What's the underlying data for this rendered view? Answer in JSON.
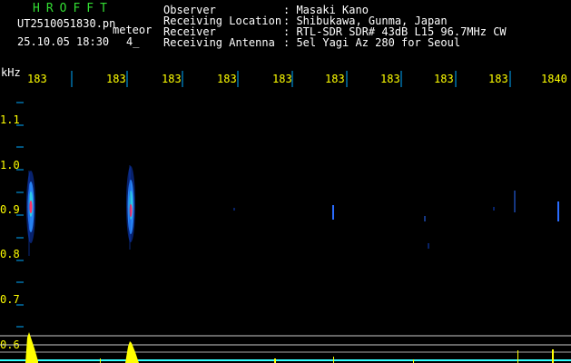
{
  "header": {
    "logo": "HROFFT",
    "filename": "UT2510051830.pn",
    "meteor_label": "meteor",
    "datetime": "25.10.05 18:30",
    "count": "4_",
    "info_labels": [
      "Observer",
      "Receiving Location",
      "Receiver",
      "Receiving Antenna"
    ],
    "info_values": [
      ": Masaki Kano",
      ": Shibukawa, Gunma, Japan",
      ": RTL-SDR SDR# 43dB L15 96.7MHz CW",
      ": 5el Yagi Az 280 for Seoul"
    ]
  },
  "axis": {
    "unit": "kHz",
    "y_ticks": [
      "1.1",
      "1.0",
      "0.9",
      "0.8",
      "0.7",
      "0.6"
    ],
    "x_ticks": [
      "183",
      "183",
      "183",
      "183",
      "183",
      "183",
      "183",
      "183",
      "183",
      "1840"
    ]
  },
  "colors": {
    "background": "#000000",
    "text_white": "#ffffff",
    "text_yellow": "#ffff00",
    "logo_green": "#33dd33",
    "tick_marks": "#00aaff",
    "signal_core": "#ff3366",
    "signal_mid": "#33aaff",
    "signal_outer": "#1144cc",
    "level_bars": "#ffff00",
    "baseline": "#33ffff"
  }
}
